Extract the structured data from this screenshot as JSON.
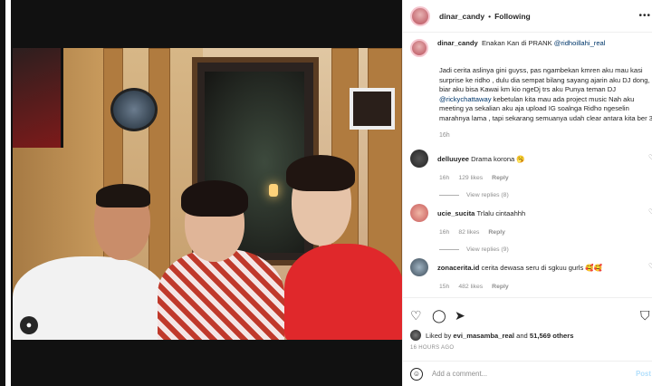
{
  "post": {
    "username": "dinar_candy",
    "follow_status": "Following",
    "more_label": "•••"
  },
  "caption": {
    "username": "dinar_candy",
    "headline_prefix": "Enakan Kan di PRANK",
    "headline_mention": "@ridhoillahi_real",
    "body_part1": "Jadi cerita aslinya gini guyss, pas ngambekan kmren aku mau kasi surprise ke ridho , dulu dia sempat bilang sayang ajarin aku DJ dong, biar aku bisa Kawai km kio ngeDj trs aku Punya teman DJ",
    "body_mention": "@rickychattaway",
    "body_part2": "kebetulan kita mau ada project music Nah aku meeting ya sekalian aku aja upload IG soalnga Ridho ngeselin marahnya lama , tapi sekarang semuanya udah clear antara kita ber 3",
    "time": "16h"
  },
  "comments": [
    {
      "username": "delluuyee",
      "text": "Drama korona 🥱",
      "time": "16h",
      "likes": "129 likes",
      "reply": "Reply",
      "view_replies": "View replies (8)"
    },
    {
      "username": "ucie_sucita",
      "text": "Trlalu cintaahhh",
      "time": "16h",
      "likes": "82 likes",
      "reply": "Reply",
      "view_replies": "View replies (9)"
    },
    {
      "username": "zonacerita.id",
      "text": "cerita dewasa seru di sgkuu gurls 🥰🥰",
      "time": "15h",
      "likes": "482 likes",
      "reply": "Reply"
    }
  ],
  "actions": {
    "like_icon": "heart-icon",
    "comment_icon": "comment-icon",
    "share_icon": "send-icon",
    "save_icon": "bookmark-icon"
  },
  "likes_summary": {
    "prefix": "Liked by",
    "user": "evi_masamba_real",
    "middle": "and",
    "count": "51,569 others"
  },
  "post_time": "16 HOURS AGO",
  "add_comment": {
    "placeholder": "Add a comment...",
    "post_label": "Post"
  }
}
